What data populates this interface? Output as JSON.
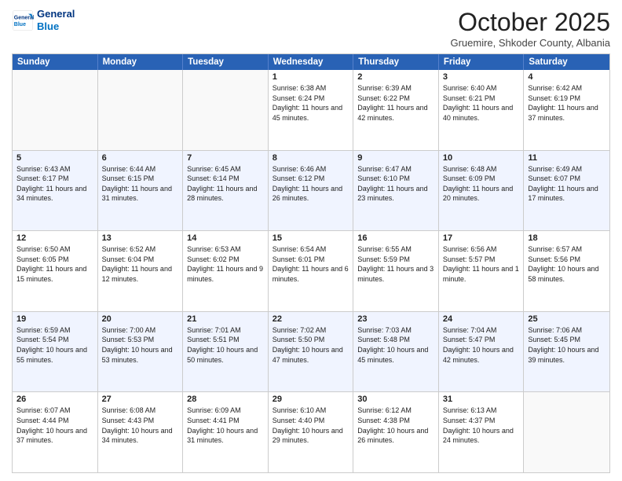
{
  "header": {
    "logo_line1": "General",
    "logo_line2": "Blue",
    "month_title": "October 2025",
    "subtitle": "Gruemire, Shkoder County, Albania"
  },
  "weekdays": [
    "Sunday",
    "Monday",
    "Tuesday",
    "Wednesday",
    "Thursday",
    "Friday",
    "Saturday"
  ],
  "rows": [
    [
      {
        "day": "",
        "info": ""
      },
      {
        "day": "",
        "info": ""
      },
      {
        "day": "",
        "info": ""
      },
      {
        "day": "1",
        "info": "Sunrise: 6:38 AM\nSunset: 6:24 PM\nDaylight: 11 hours and 45 minutes."
      },
      {
        "day": "2",
        "info": "Sunrise: 6:39 AM\nSunset: 6:22 PM\nDaylight: 11 hours and 42 minutes."
      },
      {
        "day": "3",
        "info": "Sunrise: 6:40 AM\nSunset: 6:21 PM\nDaylight: 11 hours and 40 minutes."
      },
      {
        "day": "4",
        "info": "Sunrise: 6:42 AM\nSunset: 6:19 PM\nDaylight: 11 hours and 37 minutes."
      }
    ],
    [
      {
        "day": "5",
        "info": "Sunrise: 6:43 AM\nSunset: 6:17 PM\nDaylight: 11 hours and 34 minutes."
      },
      {
        "day": "6",
        "info": "Sunrise: 6:44 AM\nSunset: 6:15 PM\nDaylight: 11 hours and 31 minutes."
      },
      {
        "day": "7",
        "info": "Sunrise: 6:45 AM\nSunset: 6:14 PM\nDaylight: 11 hours and 28 minutes."
      },
      {
        "day": "8",
        "info": "Sunrise: 6:46 AM\nSunset: 6:12 PM\nDaylight: 11 hours and 26 minutes."
      },
      {
        "day": "9",
        "info": "Sunrise: 6:47 AM\nSunset: 6:10 PM\nDaylight: 11 hours and 23 minutes."
      },
      {
        "day": "10",
        "info": "Sunrise: 6:48 AM\nSunset: 6:09 PM\nDaylight: 11 hours and 20 minutes."
      },
      {
        "day": "11",
        "info": "Sunrise: 6:49 AM\nSunset: 6:07 PM\nDaylight: 11 hours and 17 minutes."
      }
    ],
    [
      {
        "day": "12",
        "info": "Sunrise: 6:50 AM\nSunset: 6:05 PM\nDaylight: 11 hours and 15 minutes."
      },
      {
        "day": "13",
        "info": "Sunrise: 6:52 AM\nSunset: 6:04 PM\nDaylight: 11 hours and 12 minutes."
      },
      {
        "day": "14",
        "info": "Sunrise: 6:53 AM\nSunset: 6:02 PM\nDaylight: 11 hours and 9 minutes."
      },
      {
        "day": "15",
        "info": "Sunrise: 6:54 AM\nSunset: 6:01 PM\nDaylight: 11 hours and 6 minutes."
      },
      {
        "day": "16",
        "info": "Sunrise: 6:55 AM\nSunset: 5:59 PM\nDaylight: 11 hours and 3 minutes."
      },
      {
        "day": "17",
        "info": "Sunrise: 6:56 AM\nSunset: 5:57 PM\nDaylight: 11 hours and 1 minute."
      },
      {
        "day": "18",
        "info": "Sunrise: 6:57 AM\nSunset: 5:56 PM\nDaylight: 10 hours and 58 minutes."
      }
    ],
    [
      {
        "day": "19",
        "info": "Sunrise: 6:59 AM\nSunset: 5:54 PM\nDaylight: 10 hours and 55 minutes."
      },
      {
        "day": "20",
        "info": "Sunrise: 7:00 AM\nSunset: 5:53 PM\nDaylight: 10 hours and 53 minutes."
      },
      {
        "day": "21",
        "info": "Sunrise: 7:01 AM\nSunset: 5:51 PM\nDaylight: 10 hours and 50 minutes."
      },
      {
        "day": "22",
        "info": "Sunrise: 7:02 AM\nSunset: 5:50 PM\nDaylight: 10 hours and 47 minutes."
      },
      {
        "day": "23",
        "info": "Sunrise: 7:03 AM\nSunset: 5:48 PM\nDaylight: 10 hours and 45 minutes."
      },
      {
        "day": "24",
        "info": "Sunrise: 7:04 AM\nSunset: 5:47 PM\nDaylight: 10 hours and 42 minutes."
      },
      {
        "day": "25",
        "info": "Sunrise: 7:06 AM\nSunset: 5:45 PM\nDaylight: 10 hours and 39 minutes."
      }
    ],
    [
      {
        "day": "26",
        "info": "Sunrise: 6:07 AM\nSunset: 4:44 PM\nDaylight: 10 hours and 37 minutes."
      },
      {
        "day": "27",
        "info": "Sunrise: 6:08 AM\nSunset: 4:43 PM\nDaylight: 10 hours and 34 minutes."
      },
      {
        "day": "28",
        "info": "Sunrise: 6:09 AM\nSunset: 4:41 PM\nDaylight: 10 hours and 31 minutes."
      },
      {
        "day": "29",
        "info": "Sunrise: 6:10 AM\nSunset: 4:40 PM\nDaylight: 10 hours and 29 minutes."
      },
      {
        "day": "30",
        "info": "Sunrise: 6:12 AM\nSunset: 4:38 PM\nDaylight: 10 hours and 26 minutes."
      },
      {
        "day": "31",
        "info": "Sunrise: 6:13 AM\nSunset: 4:37 PM\nDaylight: 10 hours and 24 minutes."
      },
      {
        "day": "",
        "info": ""
      }
    ]
  ]
}
